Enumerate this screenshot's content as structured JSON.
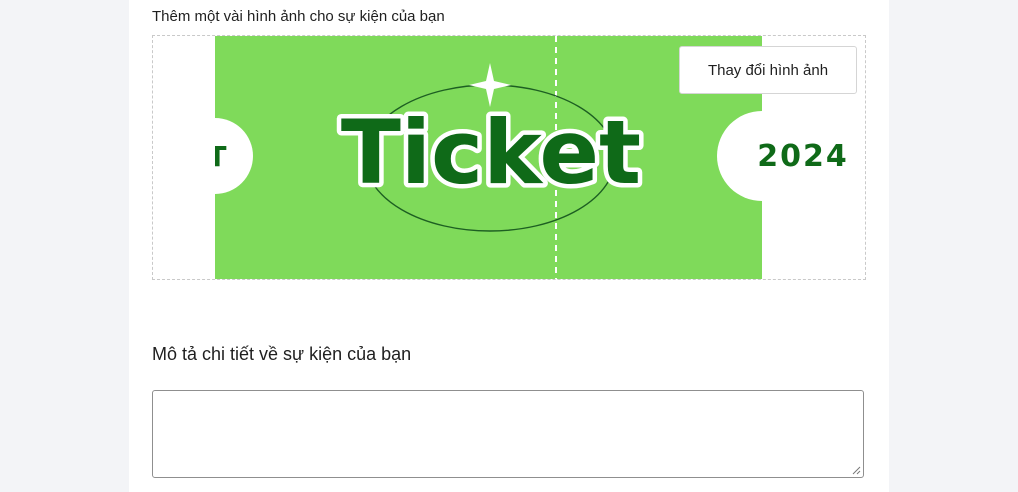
{
  "images_section": {
    "label": "Thêm một vài hình ảnh cho sự kiện của bạn",
    "change_button_label": "Thay đổi hình ảnh",
    "ticket_image": {
      "left_text": "TT",
      "main_text": "Ticket",
      "right_text": "2024",
      "colors": {
        "ticket_green": "#7fda5a",
        "text_dark_green": "#0f6a18",
        "background": "#ffffff"
      }
    }
  },
  "description_section": {
    "label": "Mô tả chi tiết về sự kiện của bạn",
    "input_value": "",
    "input_placeholder": ""
  }
}
